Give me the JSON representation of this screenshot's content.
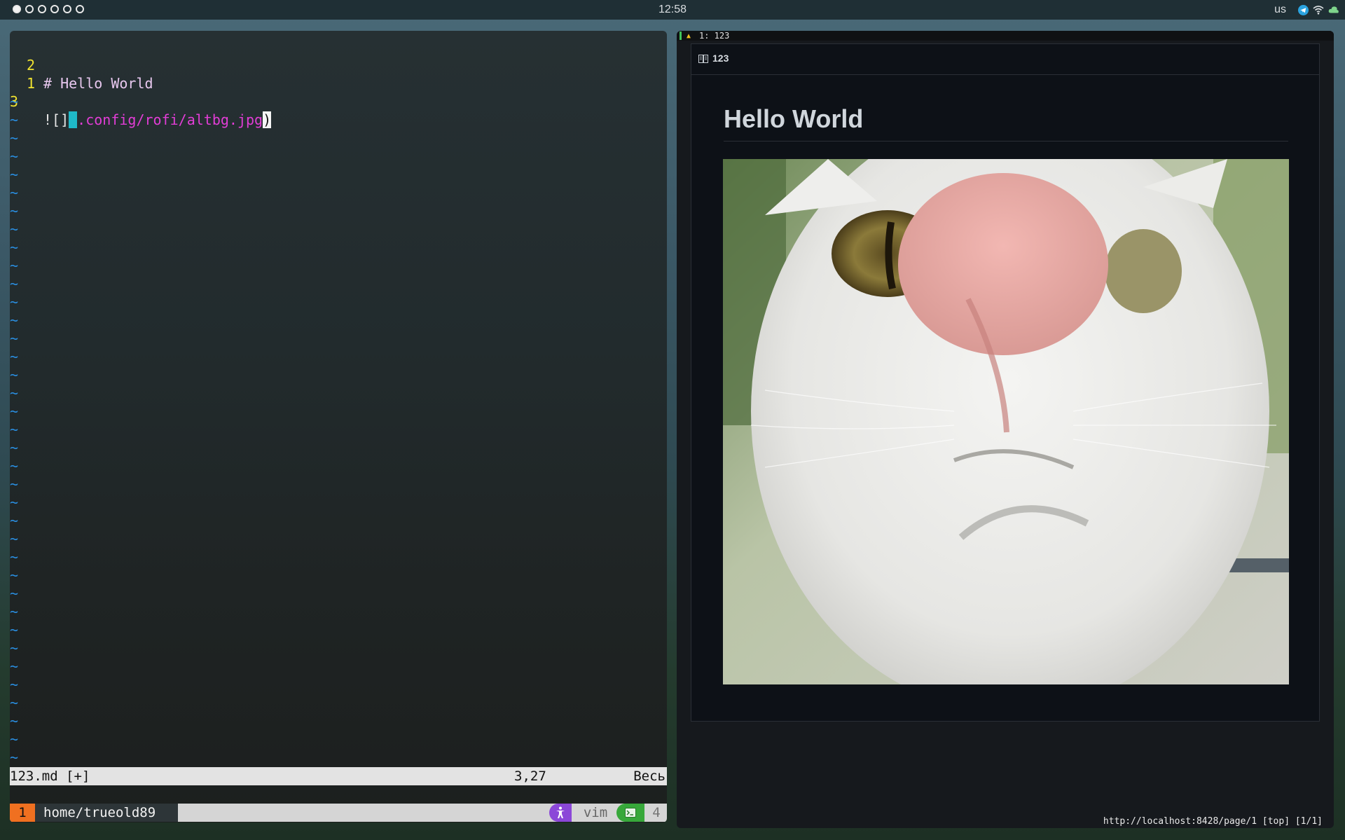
{
  "topbar": {
    "workspaces": [
      true,
      false,
      false,
      false,
      false,
      false
    ],
    "clock": "12:58",
    "keyboard_layout": "us",
    "tray_icons": [
      "telegram-icon",
      "wifi-icon",
      "cloud-icon"
    ]
  },
  "vim": {
    "lines": [
      {
        "number": "2",
        "text": "# Hello World"
      },
      {
        "number": "1",
        "text": ""
      },
      {
        "number": "3",
        "bang": "![]",
        "open_paren": "(",
        "path": ".config/rofi/altbg.jpg",
        "close_paren": ")"
      }
    ],
    "tilde": "~",
    "status": {
      "file": "123.md [+]",
      "position": "3,27",
      "scroll": "Весь"
    }
  },
  "tmux": {
    "window_number": "1",
    "path": "home/trueold89",
    "process": "vim",
    "pane_count": "4"
  },
  "browser": {
    "tab_label": "1: 123",
    "page_header_label": "123",
    "heading": "Hello World",
    "image_alt": "cat photo",
    "status_url": "http://localhost:8428/page/1 [top] [1/1]"
  },
  "colors": {
    "vim_line_number": "#f0e230",
    "vim_tilde": "#2a8ee0",
    "vim_path": "#e23dd6",
    "vim_paren_highlight": "#1fb9c8",
    "tmux_window": "#f07020",
    "tmux_accessibility": "#8b47d8",
    "tmux_terminal": "#37a83a",
    "page_background": "#0d1117"
  }
}
